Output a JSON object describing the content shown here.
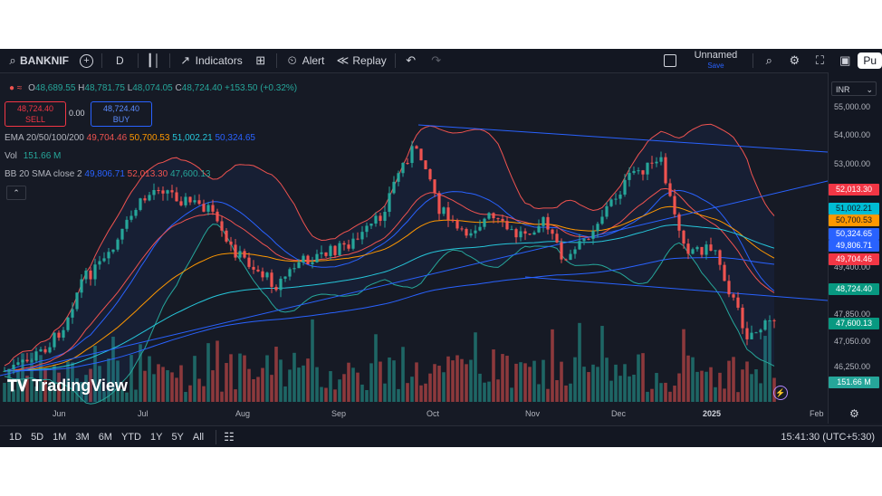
{
  "toolbar": {
    "symbol": "BANKNIF",
    "interval": "D",
    "indicators": "Indicators",
    "alert": "Alert",
    "replay": "Replay",
    "layout_name": "Unnamed",
    "layout_status": "Save",
    "publish": "Pu"
  },
  "legend": {
    "ohlc": {
      "o_label": "O",
      "o": "48,689.55",
      "h_label": "H",
      "h": "48,781.75",
      "l_label": "L",
      "l": "48,074.05",
      "c_label": "C",
      "c": "48,724.40",
      "change": "+153.50 (+0.32%)"
    },
    "sell_price": "48,724.40",
    "sell_label": "SELL",
    "spread": "0.00",
    "buy_price": "48,724.40",
    "buy_label": "BUY",
    "ema_label": "EMA 20/50/100/200",
    "ema_values": [
      "49,704.46",
      "50,700.53",
      "51,002.21",
      "50,324.65"
    ],
    "vol_label": "Vol",
    "vol_value": "151.66 M",
    "bb_label": "BB 20 SMA close 2",
    "bb_values": [
      "49,806.71",
      "52,013.30",
      "47,600.13"
    ]
  },
  "axis": {
    "currency": "INR",
    "ticks": [
      "55,000.00",
      "54,000.00",
      "53,000.00",
      "49,400.00",
      "47,850.00",
      "47,050.00",
      "46,250.00"
    ],
    "tags": [
      {
        "value": "52,013.30",
        "bg": "#f23645"
      },
      {
        "value": "51,002.21",
        "bg": "#00bcd4"
      },
      {
        "value": "50,700.53",
        "bg": "#ff9800"
      },
      {
        "value": "50,324.65",
        "bg": "#2962ff"
      },
      {
        "value": "49,806.71",
        "bg": "#2962ff"
      },
      {
        "value": "49,704.46",
        "bg": "#f23645"
      },
      {
        "value": "48,724.40",
        "bg": "#089981"
      },
      {
        "value": "47,600.13",
        "bg": "#089981"
      },
      {
        "value": "151.66 M",
        "bg": "#26a69a"
      }
    ]
  },
  "time_axis": [
    "Jun",
    "Jul",
    "Aug",
    "Sep",
    "Oct",
    "Nov",
    "Dec",
    "2025",
    "Feb"
  ],
  "bottom": {
    "ranges": [
      "1D",
      "5D",
      "1M",
      "3M",
      "6M",
      "YTD",
      "1Y",
      "5Y",
      "All"
    ],
    "clock": "15:41:30 (UTC+5:30)"
  },
  "watermark": "TradingView",
  "colors": {
    "up": "#26a69a",
    "down": "#ef5350",
    "background": "#161a25"
  }
}
